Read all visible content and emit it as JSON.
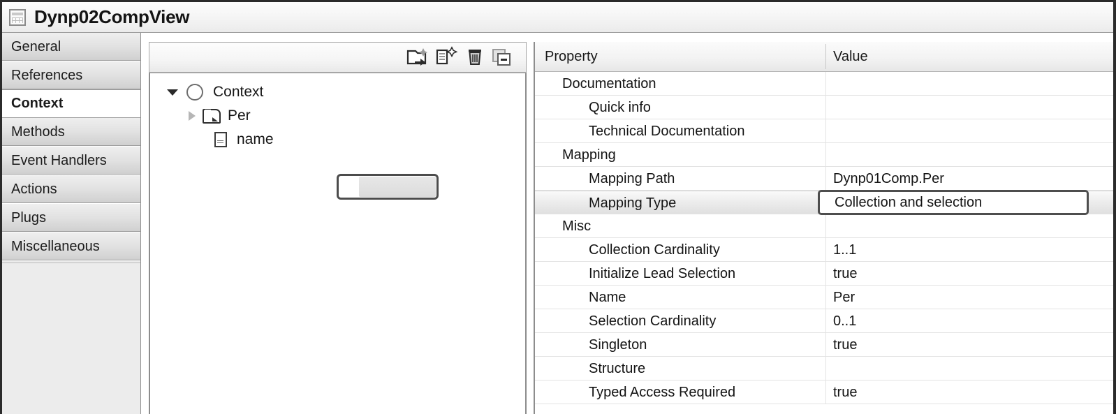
{
  "window": {
    "title": "Dynp02CompView",
    "title_icon": "table-grid-icon"
  },
  "sidebar": {
    "items": [
      {
        "label": "General",
        "active": false
      },
      {
        "label": "References",
        "active": false
      },
      {
        "label": "Context",
        "active": true
      },
      {
        "label": "Methods",
        "active": false
      },
      {
        "label": "Event Handlers",
        "active": false
      },
      {
        "label": "Actions",
        "active": false
      },
      {
        "label": "Plugs",
        "active": false
      },
      {
        "label": "Miscellaneous",
        "active": false
      }
    ]
  },
  "tree_panel": {
    "toolbar": [
      {
        "name": "new-node-icon",
        "title": "Create Node"
      },
      {
        "name": "new-attribute-icon",
        "title": "Create Attribute"
      },
      {
        "name": "delete-icon",
        "title": "Delete"
      },
      {
        "name": "collapse-all-icon",
        "title": "Collapse"
      }
    ],
    "tree": [
      {
        "label": "Context",
        "icon": "context-circle-icon",
        "expander": "expanded",
        "selected": false
      },
      {
        "label": "Per",
        "icon": "node-folder-icon",
        "expander": "collapsed",
        "selected": true
      },
      {
        "label": "name",
        "icon": "attribute-doc-icon",
        "expander": "none",
        "selected": false
      }
    ]
  },
  "property_table": {
    "columns": [
      "Property",
      "Value"
    ],
    "rows": [
      {
        "label": "Documentation",
        "value": "",
        "level": "group",
        "selected": false
      },
      {
        "label": "Quick info",
        "value": "",
        "level": "child",
        "selected": false
      },
      {
        "label": "Technical Documentation",
        "value": "",
        "level": "child",
        "selected": false
      },
      {
        "label": "Mapping",
        "value": "",
        "level": "group",
        "selected": false
      },
      {
        "label": "Mapping Path",
        "value": "Dynp01Comp.Per",
        "level": "child",
        "selected": false
      },
      {
        "label": "Mapping Type",
        "value": "Collection and selection",
        "level": "child",
        "selected": true
      },
      {
        "label": "Misc",
        "value": "",
        "level": "group",
        "selected": false
      },
      {
        "label": "Collection Cardinality",
        "value": "1..1",
        "level": "child",
        "selected": false
      },
      {
        "label": "Initialize Lead Selection",
        "value": "true",
        "level": "child",
        "selected": false
      },
      {
        "label": "Name",
        "value": "Per",
        "level": "child",
        "selected": false
      },
      {
        "label": "Selection Cardinality",
        "value": "0..1",
        "level": "child",
        "selected": false
      },
      {
        "label": "Singleton",
        "value": "true",
        "level": "child",
        "selected": false
      },
      {
        "label": "Structure",
        "value": "",
        "level": "child",
        "selected": false
      },
      {
        "label": "Typed Access Required",
        "value": "true",
        "level": "child",
        "selected": false
      }
    ],
    "editing_value": "Collection and selection"
  },
  "colors": {
    "window_border": "#2b2b2b",
    "selection_border": "#4c4c4c",
    "sidebar_bg": "#ececec",
    "row_divider": "#e3e3e3"
  }
}
